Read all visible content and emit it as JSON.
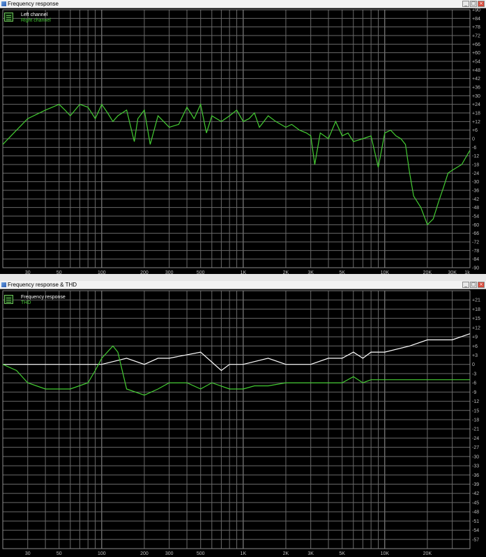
{
  "window1": {
    "title": "Frequency response",
    "legend": [
      {
        "label": "Left channel",
        "color": "#ffffff"
      },
      {
        "label": "Right channel",
        "color": "#44cc33"
      }
    ],
    "x_tick_labels": [
      "30",
      "50",
      "100",
      "200",
      "300",
      "500",
      "1K",
      "2K",
      "3K",
      "5K",
      "10K",
      "20K",
      "30K",
      "1k"
    ],
    "y_tick_labels": [
      "+90",
      "+84",
      "+78",
      "+72",
      "+66",
      "+60",
      "+54",
      "+48",
      "+42",
      "+36",
      "+30",
      "+24",
      "+18",
      "+12",
      "+6",
      "0",
      "-6",
      "-12",
      "-18",
      "-24",
      "-30",
      "-36",
      "-42",
      "-48",
      "-54",
      "-60",
      "-66",
      "-72",
      "-78",
      "-84",
      "-90"
    ]
  },
  "window2": {
    "title": "Frequency response & THD",
    "legend": [
      {
        "label": "Frequency response",
        "color": "#ffffff"
      },
      {
        "label": "THD",
        "color": "#44cc33"
      }
    ],
    "x_tick_labels": [
      "30",
      "50",
      "100",
      "200",
      "300",
      "500",
      "1K",
      "2K",
      "3K",
      "5K",
      "10K",
      "20K"
    ],
    "y_tick_labels": [
      "+21",
      "+18",
      "+15",
      "+12",
      "+9",
      "+6",
      "+3",
      "0",
      "-3",
      "-6",
      "-9",
      "-12",
      "-15",
      "-18",
      "-21",
      "-24",
      "-27",
      "-30",
      "-33",
      "-36",
      "-39",
      "-42",
      "-45",
      "-48",
      "-51",
      "-54",
      "-57"
    ]
  },
  "chart_data": [
    {
      "type": "line",
      "title": "Frequency response",
      "x_scale": "log",
      "xlim": [
        20,
        40000
      ],
      "ylim": [
        -90,
        90
      ],
      "grid": true,
      "legend_position": "top-left",
      "series": [
        {
          "name": "Right channel",
          "color": "#44cc33",
          "x": [
            20,
            25,
            30,
            40,
            50,
            55,
            60,
            70,
            80,
            90,
            100,
            110,
            120,
            130,
            150,
            170,
            180,
            200,
            220,
            250,
            300,
            350,
            400,
            450,
            500,
            550,
            600,
            700,
            800,
            900,
            1000,
            1100,
            1200,
            1300,
            1500,
            1700,
            2000,
            2200,
            2500,
            2800,
            3000,
            3200,
            3500,
            4000,
            4500,
            5000,
            5500,
            6000,
            7000,
            8000,
            9000,
            10000,
            11000,
            12000,
            13000,
            14000,
            15000,
            16000,
            18000,
            20000,
            22000,
            24000,
            26000,
            28000,
            30000,
            35000,
            40000
          ],
          "y": [
            -4,
            6,
            14,
            20,
            24,
            20,
            16,
            24,
            22,
            14,
            24,
            18,
            12,
            16,
            20,
            -2,
            14,
            20,
            -4,
            16,
            8,
            10,
            22,
            14,
            24,
            4,
            16,
            12,
            16,
            20,
            12,
            14,
            18,
            8,
            16,
            12,
            8,
            10,
            6,
            4,
            2,
            -18,
            4,
            0,
            12,
            2,
            4,
            -2,
            0,
            2,
            -20,
            4,
            6,
            2,
            0,
            -4,
            -24,
            -40,
            -48,
            -60,
            -56,
            -44,
            -34,
            -24,
            -22,
            -18,
            -8
          ]
        }
      ]
    },
    {
      "type": "line",
      "title": "Frequency response & THD",
      "x_scale": "log",
      "xlim": [
        20,
        40000
      ],
      "ylim": [
        -60,
        24
      ],
      "grid": true,
      "legend_position": "top-left",
      "series": [
        {
          "name": "Frequency response",
          "color": "#ffffff",
          "x": [
            20,
            30,
            50,
            80,
            100,
            150,
            200,
            250,
            300,
            500,
            700,
            800,
            1000,
            1500,
            2000,
            3000,
            4000,
            5000,
            6000,
            7000,
            8000,
            10000,
            15000,
            20000,
            30000,
            40000
          ],
          "y": [
            0,
            0,
            0,
            0,
            0,
            2,
            0,
            2,
            2,
            4,
            -2,
            0,
            0,
            2,
            0,
            0,
            2,
            2,
            4,
            2,
            4,
            4,
            6,
            8,
            8,
            10
          ]
        },
        {
          "name": "THD",
          "color": "#44cc33",
          "x": [
            20,
            25,
            30,
            40,
            50,
            60,
            80,
            90,
            100,
            120,
            130,
            150,
            200,
            250,
            300,
            400,
            500,
            600,
            800,
            1000,
            1200,
            1500,
            2000,
            3000,
            5000,
            6000,
            7000,
            8000,
            10000,
            20000,
            40000
          ],
          "y": [
            0,
            -2,
            -6,
            -8,
            -8,
            -8,
            -6,
            -2,
            2,
            6,
            4,
            -8,
            -10,
            -8,
            -6,
            -6,
            -8,
            -6,
            -8,
            -8,
            -7,
            -7,
            -6,
            -6,
            -6,
            -4,
            -6,
            -5,
            -5,
            -5,
            -5
          ]
        }
      ]
    }
  ]
}
